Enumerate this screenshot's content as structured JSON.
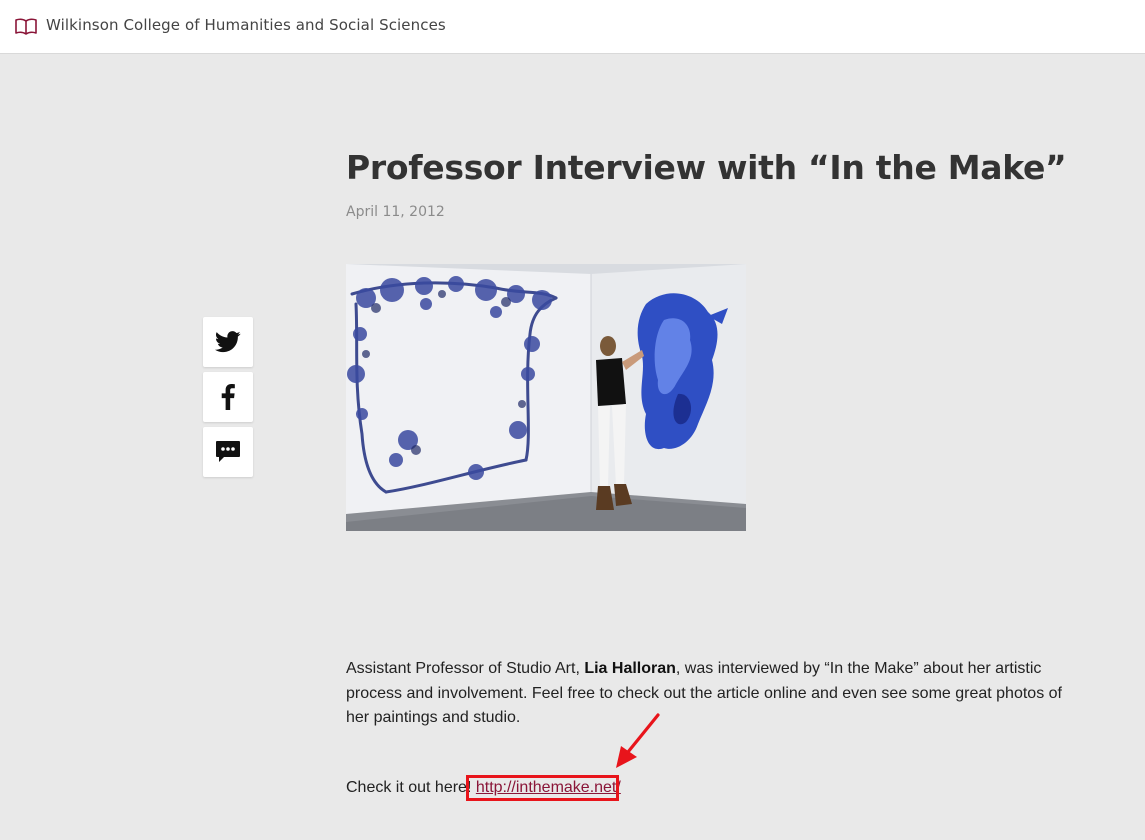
{
  "header": {
    "site_title": "Wilkinson College of Humanities and Social Sciences",
    "icon": "book-icon"
  },
  "share": {
    "icons": [
      "twitter-icon",
      "facebook-icon",
      "comment-icon"
    ]
  },
  "article": {
    "title": "Professor Interview with “In the Make”",
    "date": "April 11, 2012",
    "image_alt": "Artist painting a large blue mural on gallery wall",
    "intro_before": "Assistant Professor of Studio Art, ",
    "professor_name": "Lia Halloran",
    "intro_after": ", was interviewed by “In the Make” about her artistic process and involvement. Feel free to check out the article online and even see some great photos of her paintings and studio.",
    "check_label": "Check it out here! ",
    "link_text": "http://inthemake.net/"
  },
  "colors": {
    "accent": "#8a1538",
    "annotation": "#e8141b",
    "background": "#e9e9e9"
  }
}
